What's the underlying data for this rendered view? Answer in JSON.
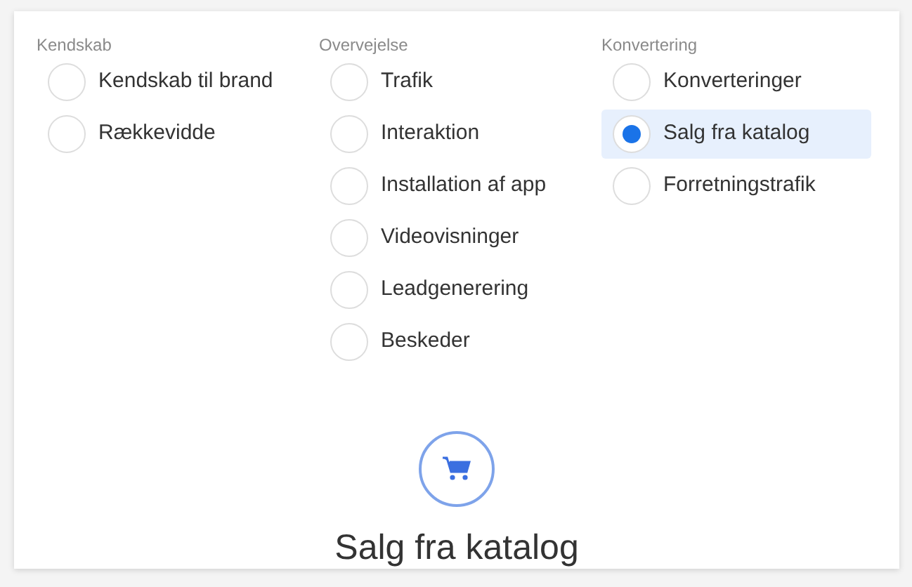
{
  "groups": [
    {
      "heading": "Kendskab",
      "options": [
        {
          "label": "Kendskab til brand",
          "selected": false
        },
        {
          "label": "Rækkevidde",
          "selected": false
        }
      ]
    },
    {
      "heading": "Overvejelse",
      "options": [
        {
          "label": "Trafik",
          "selected": false
        },
        {
          "label": "Interaktion",
          "selected": false
        },
        {
          "label": "Installation af app",
          "selected": false
        },
        {
          "label": "Videovisninger",
          "selected": false
        },
        {
          "label": "Leadgenerering",
          "selected": false
        },
        {
          "label": "Beskeder",
          "selected": false
        }
      ]
    },
    {
      "heading": "Konvertering",
      "options": [
        {
          "label": "Konverteringer",
          "selected": false
        },
        {
          "label": "Salg fra katalog",
          "selected": true
        },
        {
          "label": "Forretningstrafik",
          "selected": false
        }
      ]
    }
  ],
  "summary": {
    "title": "Salg fra katalog"
  }
}
